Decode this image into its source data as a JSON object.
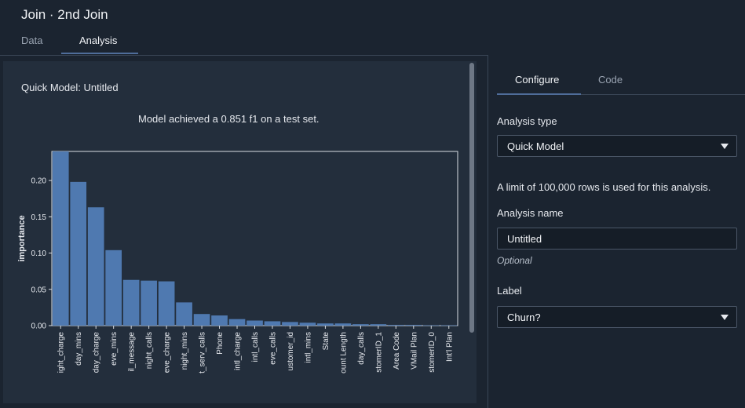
{
  "header": {
    "title": "Join · 2nd Join",
    "tabs": [
      "Data",
      "Analysis"
    ],
    "active_tab": "Analysis"
  },
  "left": {
    "quick_model_title": "Quick Model: Untitled",
    "model_message": "Model achieved a 0.851 f1 on a test set."
  },
  "right": {
    "tabs": [
      "Configure",
      "Code"
    ],
    "active_tab": "Configure",
    "analysis_type_label": "Analysis type",
    "analysis_type_value": "Quick Model",
    "limit_note": "A limit of 100,000 rows is used for this analysis.",
    "analysis_name_label": "Analysis name",
    "analysis_name_value": "Untitled",
    "optional_text": "Optional",
    "label_label": "Label",
    "label_value": "Churn?"
  },
  "chart_data": {
    "type": "bar",
    "title": "",
    "xlabel": "",
    "ylabel": "importance",
    "ylim": [
      0,
      0.24
    ],
    "yticks": [
      "0.00",
      "0.05",
      "0.10",
      "0.15",
      "0.20"
    ],
    "categories": [
      "ight_charge",
      "day_mins",
      "day_charge",
      "eve_mins",
      "il_message",
      "night_calls",
      "eve_charge",
      "night_mins",
      "t_serv_calls",
      "Phone",
      "intl_charge",
      "intl_calls",
      "eve_calls",
      "ustomer_id",
      "intl_mins",
      "State",
      "ount Length",
      "day_calls",
      "stomerID_1",
      "Area Code",
      "VMail Plan",
      "stomerID_0",
      "Int'l Plan"
    ],
    "values": [
      0.24,
      0.198,
      0.163,
      0.104,
      0.063,
      0.062,
      0.061,
      0.032,
      0.016,
      0.014,
      0.009,
      0.007,
      0.006,
      0.005,
      0.004,
      0.003,
      0.003,
      0.002,
      0.002,
      0.001,
      0.001,
      0.0005,
      0.0005
    ],
    "bar_color": "#4f79b0"
  }
}
